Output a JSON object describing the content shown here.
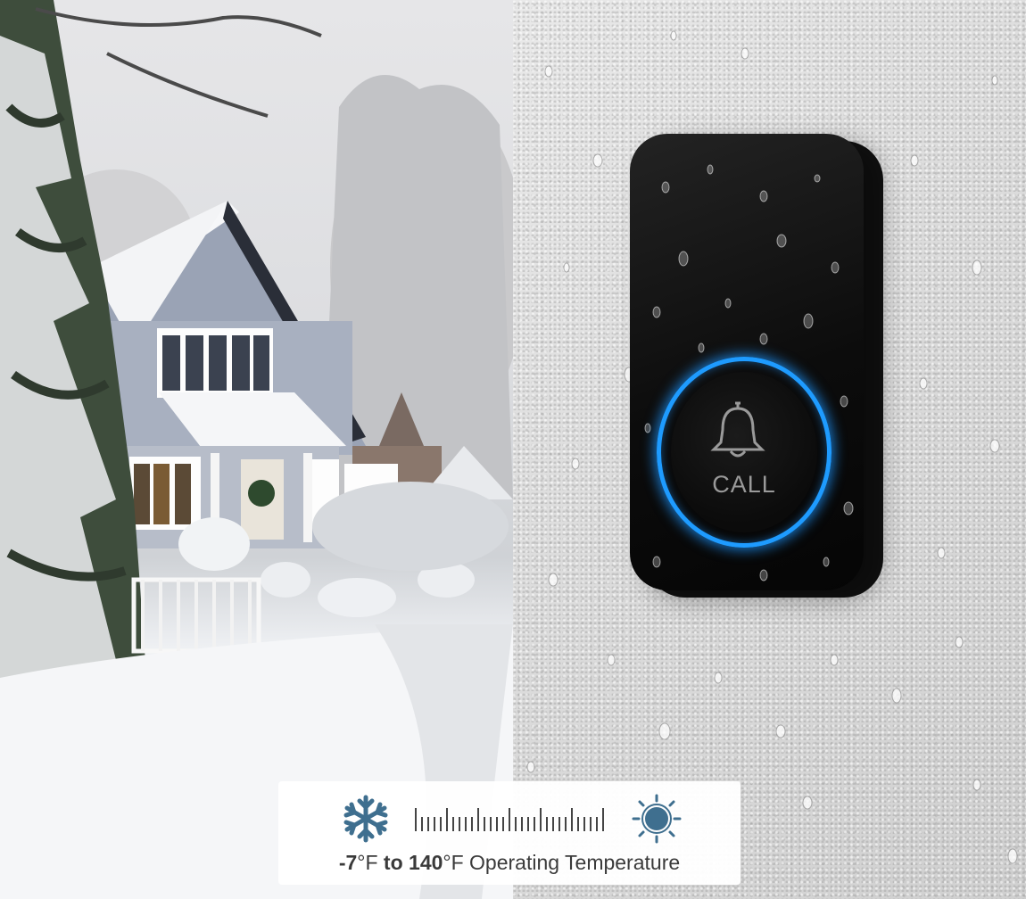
{
  "doorbell": {
    "button_label": "CALL",
    "ring_color": "#1e9bff",
    "body_color": "#0c0c0c",
    "icon": "bell-icon"
  },
  "temperature_panel": {
    "min_value": "-7",
    "min_unit": "°F",
    "connector": "to",
    "max_value": "140",
    "max_unit": "°F",
    "suffix": "Operating Temperature",
    "cold_icon": "snowflake-icon",
    "hot_icon": "sun-icon",
    "icon_color": "#3f6f8f"
  }
}
